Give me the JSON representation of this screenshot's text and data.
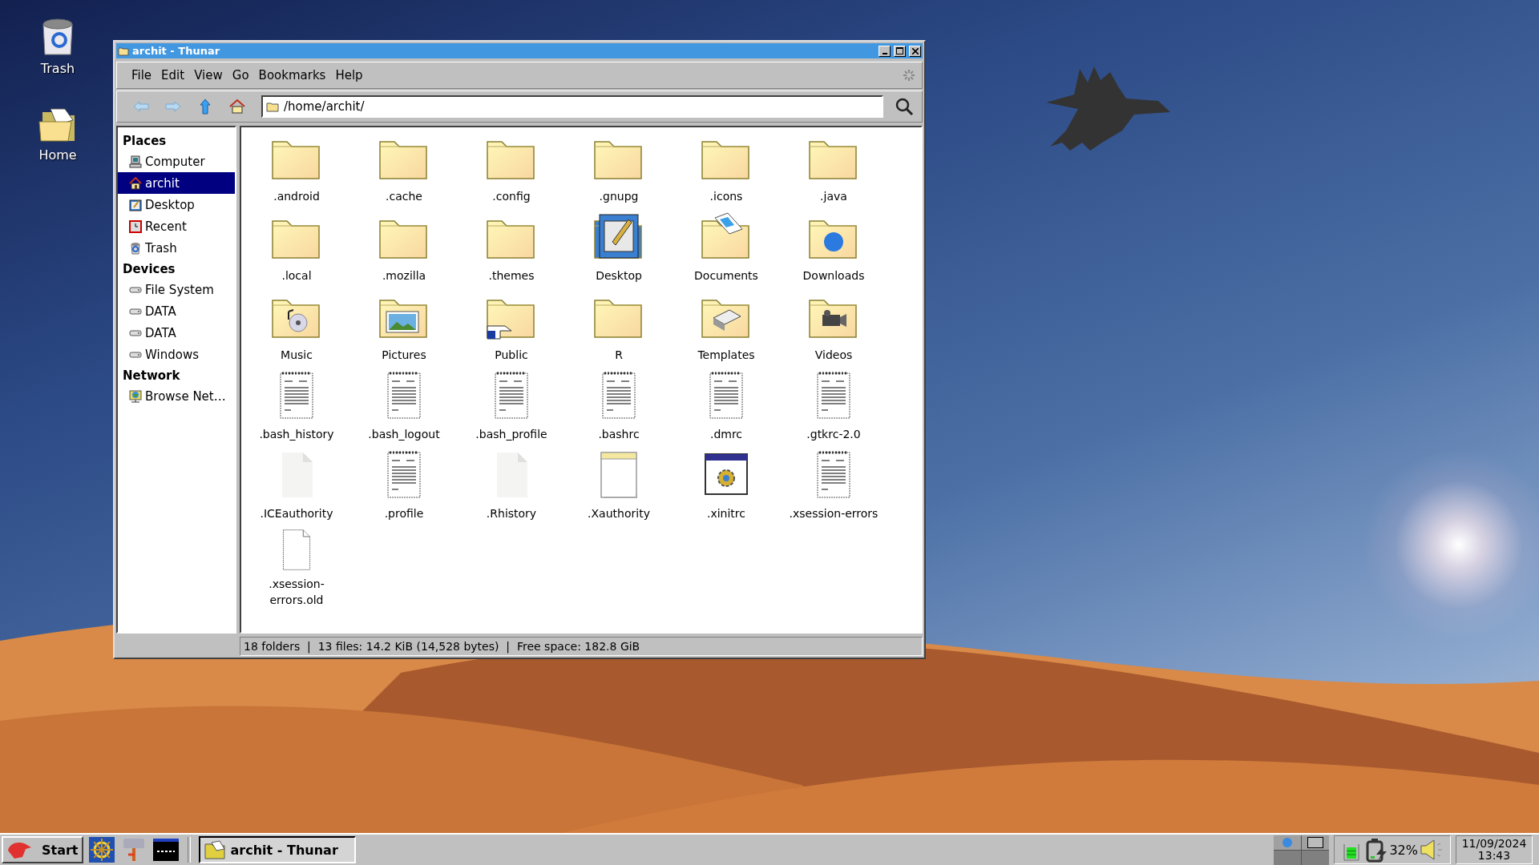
{
  "desktop_icons": [
    {
      "label": "Trash",
      "kind": "trash"
    },
    {
      "label": "Home",
      "kind": "home"
    }
  ],
  "window": {
    "title": "archit - Thunar",
    "menu": [
      "File",
      "Edit",
      "View",
      "Go",
      "Bookmarks",
      "Help"
    ],
    "location": "/home/archit/",
    "sidebar": [
      {
        "heading": "Places",
        "items": [
          {
            "label": "Computer",
            "kind": "computer",
            "selected": false
          },
          {
            "label": "archit",
            "kind": "home",
            "selected": true
          },
          {
            "label": "Desktop",
            "kind": "desktop",
            "selected": false
          },
          {
            "label": "Recent",
            "kind": "recent",
            "selected": false
          },
          {
            "label": "Trash",
            "kind": "trash",
            "selected": false
          }
        ]
      },
      {
        "heading": "Devices",
        "items": [
          {
            "label": "File System",
            "kind": "drive",
            "selected": false
          },
          {
            "label": "DATA",
            "kind": "drive",
            "selected": false
          },
          {
            "label": "DATA",
            "kind": "drive",
            "selected": false
          },
          {
            "label": "Windows",
            "kind": "drive",
            "selected": false
          }
        ]
      },
      {
        "heading": "Network",
        "items": [
          {
            "label": "Browse Net…",
            "kind": "network",
            "selected": false
          }
        ]
      }
    ],
    "files": [
      {
        "name": ".android",
        "kind": "folder"
      },
      {
        "name": ".cache",
        "kind": "folder"
      },
      {
        "name": ".config",
        "kind": "folder"
      },
      {
        "name": ".gnupg",
        "kind": "folder"
      },
      {
        "name": ".icons",
        "kind": "folder"
      },
      {
        "name": ".java",
        "kind": "folder"
      },
      {
        "name": ".local",
        "kind": "folder"
      },
      {
        "name": ".mozilla",
        "kind": "folder"
      },
      {
        "name": ".themes",
        "kind": "folder"
      },
      {
        "name": "Desktop",
        "kind": "desktop"
      },
      {
        "name": "Documents",
        "kind": "documents"
      },
      {
        "name": "Downloads",
        "kind": "downloads"
      },
      {
        "name": "Music",
        "kind": "music"
      },
      {
        "name": "Pictures",
        "kind": "pictures"
      },
      {
        "name": "Public",
        "kind": "public"
      },
      {
        "name": "R",
        "kind": "folder"
      },
      {
        "name": "Templates",
        "kind": "templates"
      },
      {
        "name": "Videos",
        "kind": "videos"
      },
      {
        "name": ".bash_history",
        "kind": "text"
      },
      {
        "name": ".bash_logout",
        "kind": "text"
      },
      {
        "name": ".bash_profile",
        "kind": "text"
      },
      {
        "name": ".bashrc",
        "kind": "text"
      },
      {
        "name": ".dmrc",
        "kind": "text"
      },
      {
        "name": ".gtkrc-2.0",
        "kind": "text"
      },
      {
        "name": ".ICEauthority",
        "kind": "empty"
      },
      {
        "name": ".profile",
        "kind": "text"
      },
      {
        "name": ".Rhistory",
        "kind": "empty"
      },
      {
        "name": ".Xauthority",
        "kind": "notes"
      },
      {
        "name": ".xinitrc",
        "kind": "app"
      },
      {
        "name": ".xsession-errors",
        "kind": "text"
      },
      {
        "name": ".xsession-errors.old",
        "kind": "blank"
      }
    ],
    "status_bar": "18 folders  |  13 files: 14.2 KiB (14,528 bytes)  |  Free space: 182.8 GiB"
  },
  "taskbar": {
    "start": "Start",
    "tasks": [
      {
        "label": "archit - Thunar",
        "selected": true
      }
    ],
    "battery": "32%",
    "date": "11/09/2024",
    "time": "13:43"
  }
}
